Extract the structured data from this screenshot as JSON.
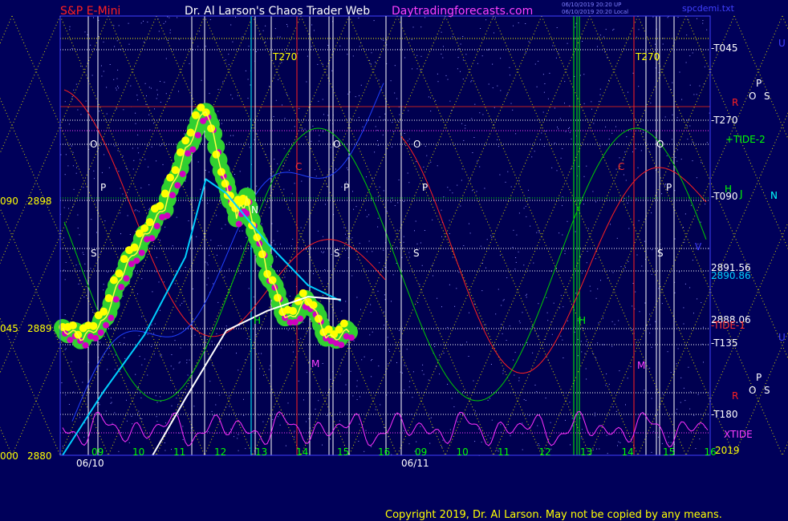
{
  "header": {
    "left_title": "S&P E-Mini",
    "center_title": "Dr. Al Larson's Chaos Trader Web",
    "site": "Daytradingforecasts.com",
    "stamp_line1": "06/10/2019 20:20 UP",
    "stamp_line2": "06/10/2019 20:20 Local",
    "file": "spcdemi.txt"
  },
  "copyright": "Copyright 2019, Dr. Al Larson. May not be copied by any means.",
  "chart_data": {
    "type": "line",
    "title": "S&P E-Mini",
    "x_date_labels": [
      "06/10",
      "06/11"
    ],
    "x_hour_ticks_day1": [
      "09",
      "10",
      "11",
      "12",
      "13",
      "14",
      "15",
      "16"
    ],
    "x_hour_ticks_day2": [
      "09",
      "10",
      "11",
      "12",
      "13",
      "14",
      "15",
      "16"
    ],
    "year_label": "2019",
    "y_axis_left": [
      {
        "label": "090",
        "value": 2898
      },
      {
        "label": "045",
        "value": 2889
      },
      {
        "label": "000",
        "value": 2880
      }
    ],
    "ylim": [
      2880,
      2898
    ],
    "right_price_labels": [
      {
        "text": "2891.56",
        "value": 2891.56
      },
      {
        "text": "2890.86",
        "value": 2890.86
      },
      {
        "text": "2888.06",
        "value": 2888.06
      }
    ],
    "right_line_labels": [
      {
        "text": "-T045",
        "color": "#ffffff"
      },
      {
        "text": "-T270",
        "color": "#ffffff"
      },
      {
        "text": "+TIDE-2",
        "color": "#00ff00"
      },
      {
        "text": "-T090",
        "color": "#ffffff"
      },
      {
        "text": "-TIDE-1",
        "color": "#ff3030"
      },
      {
        "text": "-T135",
        "color": "#ffffff"
      },
      {
        "text": "-T180",
        "color": "#ffffff"
      },
      {
        "text": "XTIDE",
        "color": "#ff40ff"
      }
    ],
    "in_chart_labels": [
      "T270",
      "O",
      "P",
      "S",
      "H",
      "N",
      "M",
      "R",
      "V"
    ],
    "series": [
      {
        "x": [
          0,
          0.5,
          1,
          1.5,
          2,
          2.5,
          3,
          3.5,
          4,
          4.25,
          4.5,
          5,
          5.5,
          6,
          6.5,
          7
        ],
        "values": [
          2889,
          2888.2,
          2889.5,
          2893,
          2895.5,
          2897.5,
          2901.5,
          2904.5,
          2899,
          2897,
          2898,
          2893,
          2889.5,
          2891,
          2888.2,
          2888.7
        ]
      },
      {
        "x": [
          0,
          1,
          2,
          3,
          3.5,
          4,
          5,
          6,
          6.8
        ],
        "values": [
          2880,
          2884.5,
          2888.5,
          2894,
          2899.5,
          2898.5,
          2895,
          2892,
          2890.9
        ]
      },
      {
        "x": [
          2.2,
          3,
          4,
          5,
          6,
          6.8
        ],
        "values": [
          2880,
          2884,
          2888.8,
          2890.2,
          2891.2,
          2891
        ]
      }
    ]
  }
}
